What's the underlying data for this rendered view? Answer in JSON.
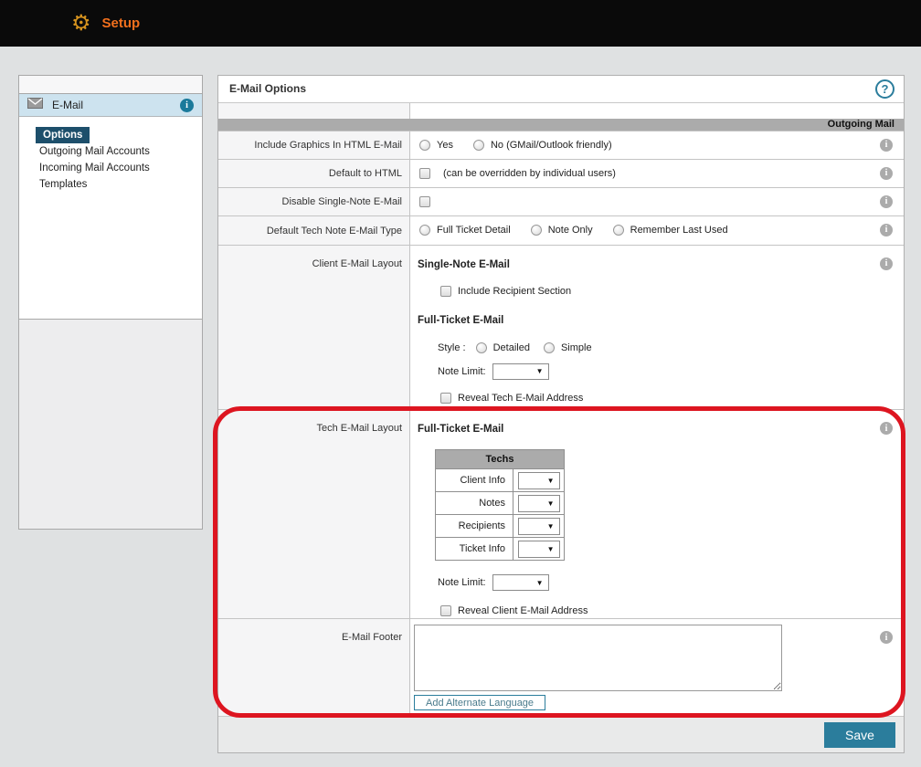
{
  "topbar": {
    "title": "Setup"
  },
  "sidebar": {
    "section_label": "E-Mail",
    "items": [
      {
        "label": "Options",
        "selected": true
      },
      {
        "label": "Outgoing Mail Accounts",
        "selected": false
      },
      {
        "label": "Incoming Mail Accounts",
        "selected": false
      },
      {
        "label": "Templates",
        "selected": false
      }
    ]
  },
  "panel": {
    "title": "E-Mail Options",
    "section_band": "Outgoing Mail",
    "rows": {
      "include_graphics": {
        "label": "Include Graphics In HTML E-Mail",
        "options": [
          "Yes",
          "No (GMail/Outlook friendly)"
        ]
      },
      "default_html": {
        "label": "Default to HTML",
        "note": "(can be overridden by individual users)"
      },
      "disable_single_note": {
        "label": "Disable Single-Note E-Mail"
      },
      "default_tech_note": {
        "label": "Default Tech Note E-Mail Type",
        "options": [
          "Full Ticket Detail",
          "Note Only",
          "Remember Last Used"
        ]
      },
      "client_layout": {
        "label": "Client E-Mail Layout",
        "single_note_heading": "Single-Note E-Mail",
        "include_recipient": "Include Recipient Section",
        "full_ticket_heading": "Full-Ticket E-Mail",
        "style_label": "Style :",
        "style_options": [
          "Detailed",
          "Simple"
        ],
        "note_limit_label": "Note Limit:",
        "reveal": "Reveal Tech E-Mail Address"
      },
      "tech_layout": {
        "label": "Tech E-Mail Layout",
        "full_ticket_heading": "Full-Ticket E-Mail",
        "table_header": "Techs",
        "table_rows": [
          "Client Info",
          "Notes",
          "Recipients",
          "Ticket Info"
        ],
        "note_limit_label": "Note Limit:",
        "reveal": "Reveal Client E-Mail Address"
      },
      "footer": {
        "label": "E-Mail Footer",
        "textarea_value": "",
        "add_button": "Add Alternate Language"
      }
    },
    "save_label": "Save"
  },
  "colors": {
    "accent_teal": "#2b7d9c",
    "nav_selected": "#1d4f6b",
    "band_gray": "#ababab",
    "annotation_red": "#dd1520",
    "topbar_orange": "#f2701d",
    "gear_gold": "#d6931e",
    "sidebar_header_blue": "#cde3ef"
  }
}
